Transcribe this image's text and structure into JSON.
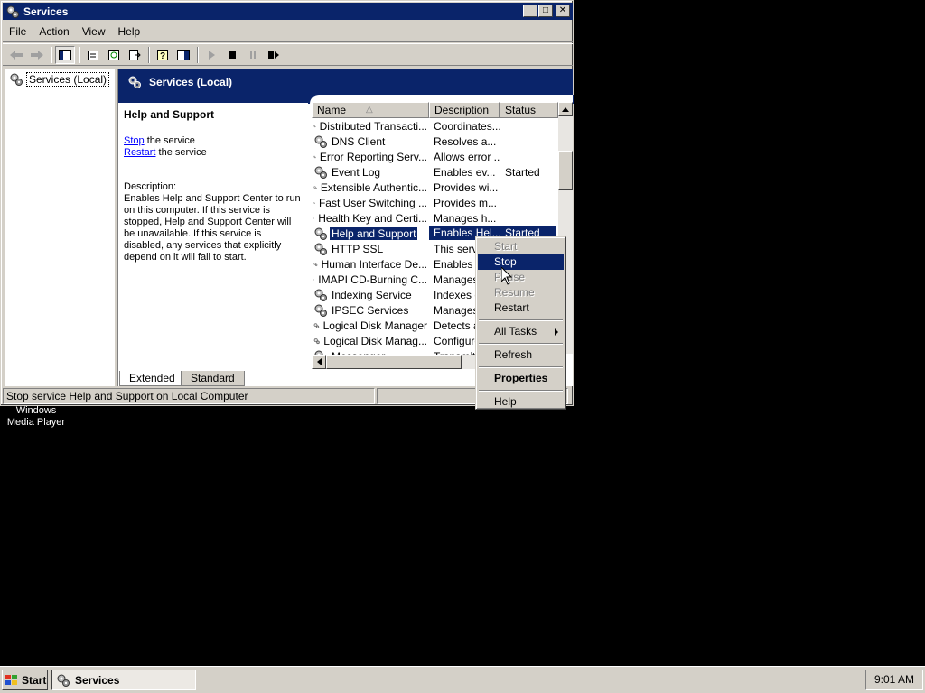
{
  "desktop": {
    "icon_label": "Windows\nMedia Player"
  },
  "window": {
    "title": "Services",
    "ctrl_min": "_",
    "ctrl_max": "□",
    "ctrl_close": "✕"
  },
  "menubar": {
    "items": [
      "File",
      "Action",
      "View",
      "Help"
    ]
  },
  "tree": {
    "root_label": "Services (Local)"
  },
  "header": {
    "title": "Services (Local)"
  },
  "desc": {
    "service_name": "Help and Support",
    "stop_link": "Stop",
    "stop_suffix": " the service",
    "restart_link": "Restart",
    "restart_suffix": " the service",
    "desc_label": "Description:",
    "desc_text": "Enables Help and Support Center to run on this computer. If this service is stopped, Help and Support Center will be unavailable. If this service is disabled, any services that explicitly depend on it will fail to start."
  },
  "list": {
    "columns": [
      "Name",
      "Description",
      "Status"
    ],
    "sort_indicator": "△",
    "rows": [
      {
        "name": "Distributed Transacti...",
        "desc": "Coordinates...",
        "status": ""
      },
      {
        "name": "DNS Client",
        "desc": "Resolves a...",
        "status": ""
      },
      {
        "name": "Error Reporting Serv...",
        "desc": "Allows error ...",
        "status": ""
      },
      {
        "name": "Event Log",
        "desc": "Enables ev...",
        "status": "Started"
      },
      {
        "name": "Extensible Authentic...",
        "desc": "Provides wi...",
        "status": ""
      },
      {
        "name": "Fast User Switching ...",
        "desc": "Provides m...",
        "status": ""
      },
      {
        "name": "Health Key and Certi...",
        "desc": "Manages h...",
        "status": ""
      },
      {
        "name": "Help and Support",
        "desc": "Enables Hel...",
        "status": "Started",
        "selected": true
      },
      {
        "name": "HTTP SSL",
        "desc": "This servi...",
        "status": ""
      },
      {
        "name": "Human Interface De...",
        "desc": "Enables g...",
        "status": ""
      },
      {
        "name": "IMAPI CD-Burning C...",
        "desc": "Manages ...",
        "status": ""
      },
      {
        "name": "Indexing Service",
        "desc": "Indexes c...",
        "status": ""
      },
      {
        "name": "IPSEC Services",
        "desc": "Manages ...",
        "status": ""
      },
      {
        "name": "Logical Disk Manager",
        "desc": "Detects a...",
        "status": ""
      },
      {
        "name": "Logical Disk Manag...",
        "desc": "Configures...",
        "status": ""
      },
      {
        "name": "Messenger",
        "desc": "Transmits...",
        "status": ""
      }
    ]
  },
  "tabs": {
    "extended": "Extended",
    "standard": "Standard"
  },
  "statusbar": {
    "text": "Stop service Help and Support on Local Computer"
  },
  "context_menu": {
    "start": "Start",
    "stop": "Stop",
    "pause": "Pause",
    "resume": "Resume",
    "restart": "Restart",
    "all_tasks": "All Tasks",
    "refresh": "Refresh",
    "properties": "Properties",
    "help": "Help"
  },
  "taskbar": {
    "start_label": "Start",
    "task_label": "Services",
    "clock": "9:01 AM"
  },
  "colors": {
    "titlebar": "#0a246a",
    "face": "#d4d0c8",
    "selection": "#0a246a",
    "link": "#0000ff"
  }
}
